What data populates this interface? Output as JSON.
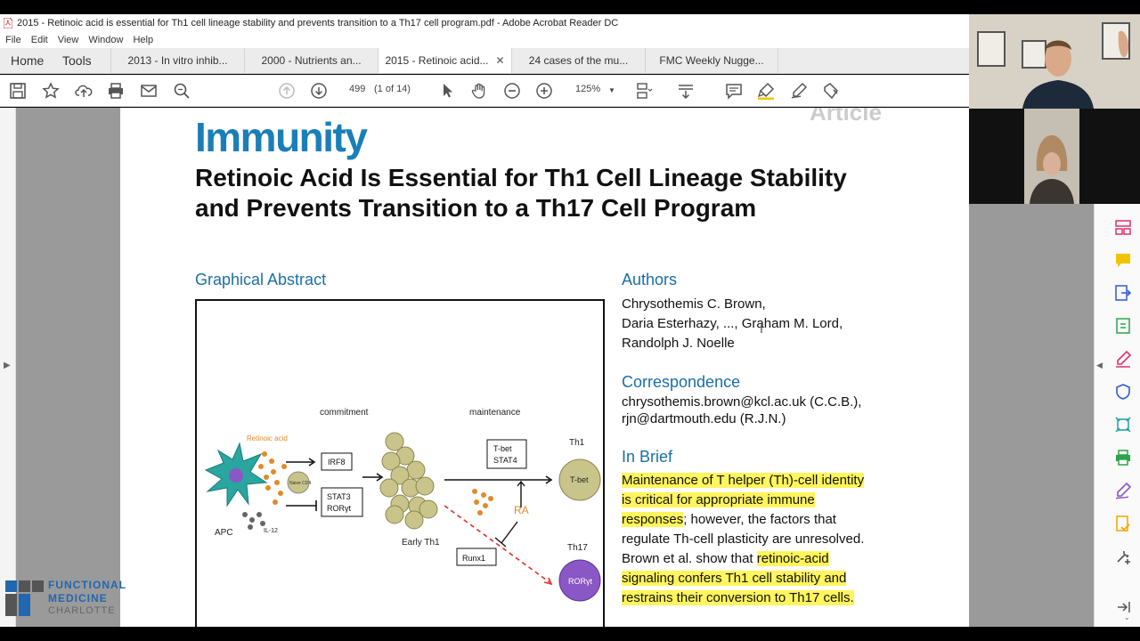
{
  "window": {
    "title": "2015 - Retinoic acid is essential for Th1 cell lineage stability and prevents transition to a Th17 cell program.pdf - Adobe Acrobat Reader DC"
  },
  "menu": [
    "File",
    "Edit",
    "View",
    "Window",
    "Help"
  ],
  "nav_tabs": [
    "Home",
    "Tools"
  ],
  "doc_tabs": [
    {
      "label": "2013 - In vitro inhib..."
    },
    {
      "label": "2000 - Nutrients an..."
    },
    {
      "label": "2015 - Retinoic acid...",
      "active": true,
      "close": "✕"
    },
    {
      "label": "24 cases of the mu..."
    },
    {
      "label": "FMC Weekly Nugge..."
    }
  ],
  "toolbar": {
    "page_number": "499",
    "page_count": "(1 of 14)",
    "zoom": "125%"
  },
  "document": {
    "journal": "Immunity",
    "article_tag": "Article",
    "title": "Retinoic Acid Is Essential for Th1 Cell Lineage Stability and Prevents Transition to a Th17 Cell Program",
    "graphical_abstract_heading": "Graphical Abstract",
    "authors_heading": "Authors",
    "authors_lines": [
      "Chrysothemis C. Brown,",
      "Daria Esterhazy, ..., Graham M. Lord,",
      "Randolph J. Noelle"
    ],
    "correspondence_heading": "Correspondence",
    "correspondence_lines": [
      "chrysothemis.brown@kcl.ac.uk (C.C.B.),",
      "rjn@dartmouth.edu (R.J.N.)"
    ],
    "in_brief_heading": "In Brief",
    "in_brief": {
      "hl1": "Maintenance of T helper (Th)-cell identity",
      "hl2": "is critical for appropriate immune",
      "hl3": "responses",
      "t1": "; however, the factors that",
      "t2": "regulate Th-cell plasticity are unresolved.",
      "t3": "Brown et al. show that ",
      "hl4": "retinoic-acid",
      "hl5": "signaling confers Th1 cell stability and",
      "hl6": "restrains their conversion to Th17 cells."
    }
  },
  "abstract": {
    "commitment": "commitment",
    "maintenance": "maintenance",
    "retinoic_acid": "Retinoic acid",
    "irf8": "IRF8",
    "naive_cd4": "Naive CD4",
    "stat3": "STAT3",
    "roryt": "RORγt",
    "apc": "APC",
    "il12": "IL-12",
    "early_th1": "Early Th1",
    "tbet_stat4_1": "T-bet",
    "tbet_stat4_2": "STAT4",
    "ra": "RA",
    "runx1": "Runx1",
    "th1": "Th1",
    "tbet": "T-bet",
    "th17": "Th17",
    "roryt_cell": "RORγt"
  },
  "logo": {
    "line1": "FUNCTIONAL",
    "line2": "MEDICINE",
    "line3": "CHARLOTTE"
  },
  "colors": {
    "accent_blue": "#1a7fb8",
    "highlight": "#fff55c",
    "hl_tool": "#f2c400"
  }
}
